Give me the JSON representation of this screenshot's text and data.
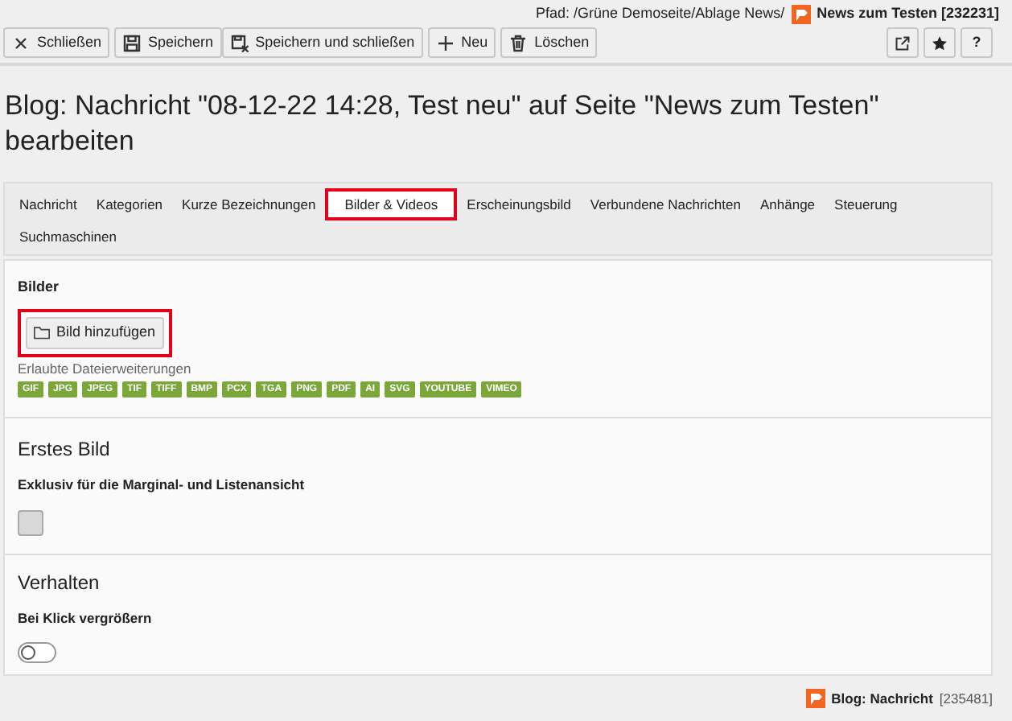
{
  "path": {
    "label": "Pfad: /Grüne Demoseite/Ablage News/",
    "current": "News zum Testen [232231]"
  },
  "toolbar": [
    {
      "label": "Schließen"
    },
    {
      "label": "Speichern"
    },
    {
      "label": "Speichern und schließen"
    },
    {
      "label": "Neu"
    },
    {
      "label": "Löschen"
    }
  ],
  "help_button": "?",
  "title": "Blog: Nachricht \"08-12-22 14:28, Test neu\" auf Seite \"News zum Testen\" bearbeiten",
  "tabs": [
    {
      "label": "Nachricht",
      "selected": false
    },
    {
      "label": "Kategorien",
      "selected": false
    },
    {
      "label": "Kurze Bezeichnungen",
      "selected": false
    },
    {
      "label": "Bilder & Videos",
      "selected": true
    },
    {
      "label": "Erscheinungsbild",
      "selected": false
    },
    {
      "label": "Verbundene Nachrichten",
      "selected": false
    },
    {
      "label": "Anhänge",
      "selected": false
    },
    {
      "label": "Steuerung",
      "selected": false
    },
    {
      "label": "Suchmaschinen",
      "selected": false
    }
  ],
  "sections": [
    {
      "kind": "upload",
      "label": "Bilder",
      "button": {
        "label": "Bild hinzufügen",
        "highlighted": true
      },
      "hint": "Erlaubte Dateierweiterungen",
      "extensions": [
        "GIF",
        "JPG",
        "JPEG",
        "TIF",
        "TIFF",
        "BMP",
        "PCX",
        "TGA",
        "PNG",
        "PDF",
        "AI",
        "SVG",
        "YOUTUBE",
        "VIMEO"
      ]
    },
    {
      "kind": "checkbox",
      "heading": "Erstes Bild",
      "label": "Exklusiv für die Marginal- und Listenansicht",
      "checked": false
    },
    {
      "kind": "switch",
      "heading": "Verhalten",
      "label": "Bei Klick vergrößern",
      "on": false
    }
  ],
  "footer": {
    "label": "Blog: Nachricht",
    "id": "[235481]"
  }
}
